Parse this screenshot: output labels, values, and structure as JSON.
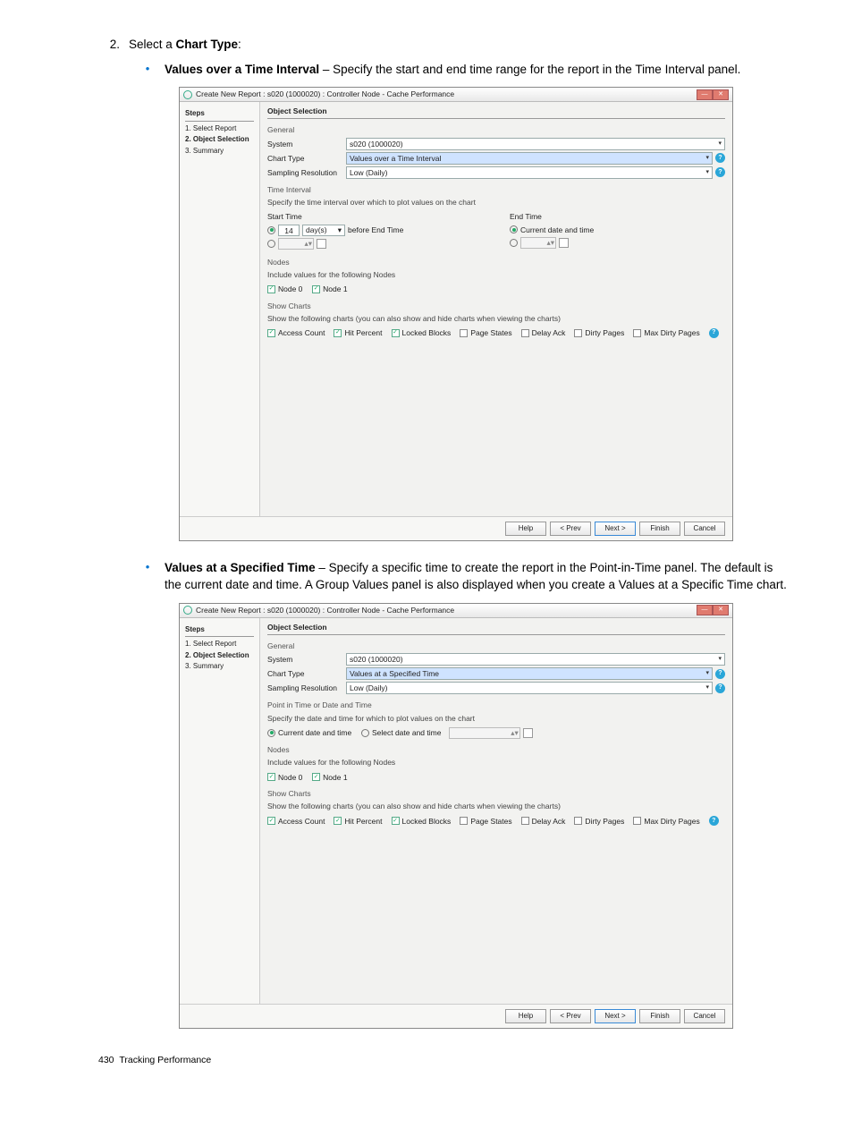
{
  "step": {
    "num": "2.",
    "text_a": "Select a ",
    "text_b": "Chart Type",
    "text_c": ":"
  },
  "bullets": {
    "b1": {
      "title": "Values over a Time Interval",
      "rest": " – Specify the start and end time range for the report in the Time Interval panel."
    },
    "b2": {
      "title": "Values at a Specified Time",
      "rest": " – Specify a specific time to create the report in the Point-in-Time panel. The default is the current date and time. A Group Values panel is also displayed when you create a Values at a Specific Time chart."
    }
  },
  "dialog_common": {
    "title": "Create New Report : s020 (1000020) : Controller Node - Cache Performance",
    "steps_hdr": "Steps",
    "steps": [
      "1. Select Report",
      "2. Object Selection",
      "3. Summary"
    ],
    "main_hdr": "Object Selection",
    "general": "General",
    "system_label": "System",
    "system_value": "s020 (1000020)",
    "chart_type_label": "Chart Type",
    "sampling_label": "Sampling Resolution",
    "sampling_value": "Low (Daily)",
    "nodes_hdr": "Nodes",
    "nodes_desc": "Include values for the following Nodes",
    "node0": "Node 0",
    "node1": "Node 1",
    "show_charts_hdr": "Show Charts",
    "show_charts_desc": "Show the following charts (you can also show and hide charts when viewing the charts)",
    "charts": [
      "Access Count",
      "Hit Percent",
      "Locked Blocks",
      "Page States",
      "Delay Ack",
      "Dirty Pages",
      "Max Dirty Pages"
    ],
    "buttons": {
      "help": "Help",
      "prev": "< Prev",
      "next": "Next >",
      "finish": "Finish",
      "cancel": "Cancel"
    }
  },
  "dialog1": {
    "chart_type_value": "Values over a Time Interval",
    "time_hdr": "Time Interval",
    "time_desc": "Specify the time interval over which to plot values on the chart",
    "start_label": "Start Time",
    "end_label": "End Time",
    "relative_amount": "14",
    "relative_unit": "day(s)",
    "before_end": "before End Time",
    "current_dt": "Current date and time"
  },
  "dialog2": {
    "chart_type_value": "Values at a Specified Time",
    "pit_hdr": "Point in Time or Date and Time",
    "pit_desc": "Specify the date and time for which to plot values on the chart",
    "pit_current": "Current date and time",
    "pit_select": "Select date and time"
  },
  "footer": {
    "page": "430",
    "section": "Tracking Performance"
  }
}
